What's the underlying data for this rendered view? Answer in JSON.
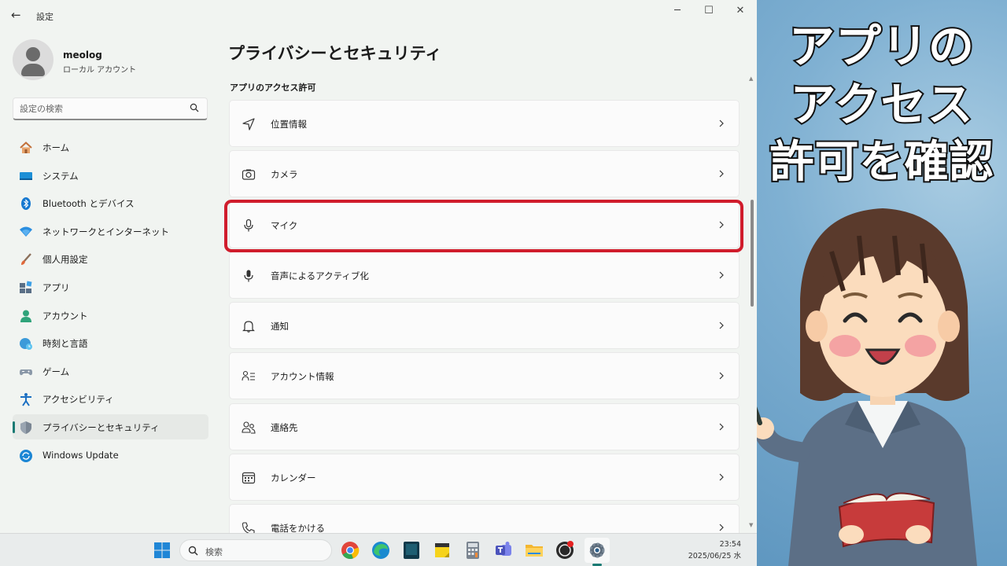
{
  "window": {
    "title": "設定",
    "back_glyph": "←",
    "controls": {
      "minimize": "─",
      "maximize": "☐",
      "close": "✕"
    }
  },
  "profile": {
    "name": "meolog",
    "account_type": "ローカル アカウント"
  },
  "search": {
    "placeholder": "設定の検索"
  },
  "sidebar": {
    "items": [
      {
        "label": "ホーム",
        "icon": "home-icon"
      },
      {
        "label": "システム",
        "icon": "system-icon"
      },
      {
        "label": "Bluetooth とデバイス",
        "icon": "bluetooth-icon"
      },
      {
        "label": "ネットワークとインターネット",
        "icon": "wifi-icon"
      },
      {
        "label": "個人用設定",
        "icon": "brush-icon"
      },
      {
        "label": "アプリ",
        "icon": "apps-icon"
      },
      {
        "label": "アカウント",
        "icon": "account-icon"
      },
      {
        "label": "時刻と言語",
        "icon": "globe-clock-icon"
      },
      {
        "label": "ゲーム",
        "icon": "gamepad-icon"
      },
      {
        "label": "アクセシビリティ",
        "icon": "accessibility-icon"
      },
      {
        "label": "プライバシーとセキュリティ",
        "icon": "shield-icon",
        "active": true
      },
      {
        "label": "Windows Update",
        "icon": "update-icon"
      }
    ]
  },
  "main": {
    "title": "プライバシーとセキュリティ",
    "section": "アプリのアクセス許可",
    "rows": [
      {
        "label": "位置情報",
        "icon": "location-icon"
      },
      {
        "label": "カメラ",
        "icon": "camera-icon"
      },
      {
        "label": "マイク",
        "icon": "microphone-icon",
        "highlighted": true
      },
      {
        "label": "音声によるアクティブ化",
        "icon": "voice-activation-icon"
      },
      {
        "label": "通知",
        "icon": "bell-icon"
      },
      {
        "label": "アカウント情報",
        "icon": "account-info-icon"
      },
      {
        "label": "連絡先",
        "icon": "contacts-icon"
      },
      {
        "label": "カレンダー",
        "icon": "calendar-icon"
      },
      {
        "label": "電話をかける",
        "icon": "phone-icon"
      }
    ]
  },
  "taskbar": {
    "search_label": "検索",
    "apps": [
      "windows-start-icon",
      "chrome-icon",
      "edge-icon",
      "kindle-icon",
      "sticky-notes-icon",
      "calculator-icon",
      "teams-icon",
      "file-explorer-icon",
      "obs-icon",
      "settings-icon"
    ],
    "time": "23:54",
    "date": "2025/06/25 水"
  },
  "overlay": {
    "lines": [
      "アプリの",
      "アクセス",
      "許可を確認"
    ]
  },
  "colors": {
    "accent": "#1a7a73",
    "highlight_border": "#d01c2c",
    "panel_bg": "#7fb0d2"
  }
}
